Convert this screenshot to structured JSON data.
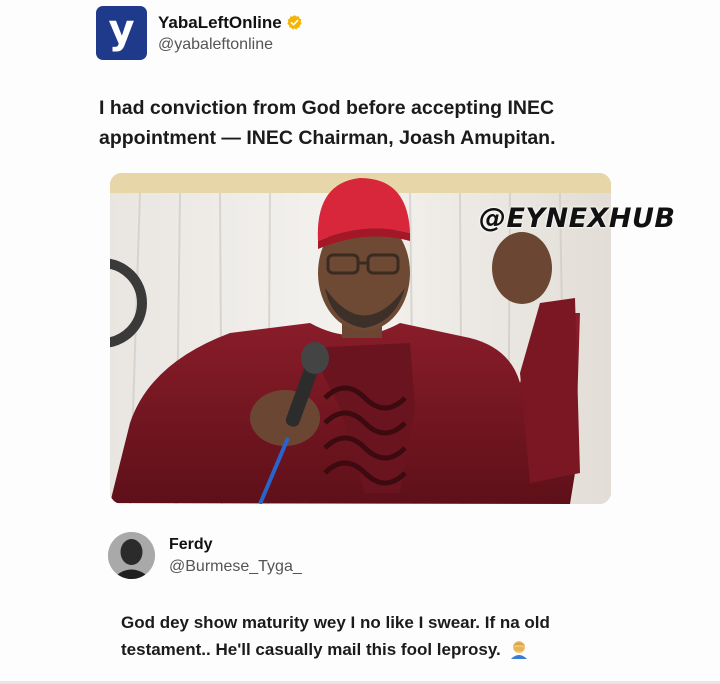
{
  "post": {
    "logo_letter": "y",
    "display_name": "YabaLeftOnline",
    "handle": "@yabaleftonline",
    "text": "I had conviction from God before accepting INEC appointment — INEC Chairman, Joash Amupitan.",
    "watermark": "@EYNEXHUB",
    "colors": {
      "logo_bg": "#1f3a8a",
      "verified": "#f5b400"
    }
  },
  "reply": {
    "display_name": "Ferdy",
    "handle": "@Burmese_Tyga_",
    "text": "God dey show maturity wey I no like I swear. If na old testament.. He'll casually mail this fool leprosy.",
    "emoji": "man-facepalming-emoji"
  }
}
